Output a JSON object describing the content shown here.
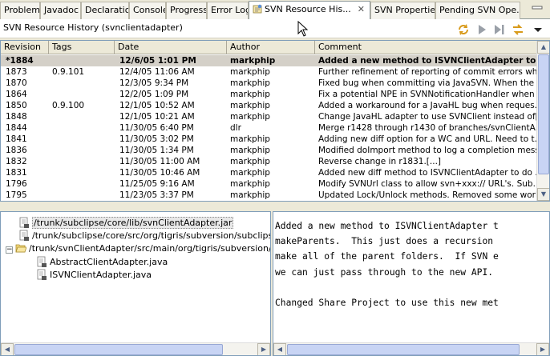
{
  "tabs": [
    {
      "label": "Problems"
    },
    {
      "label": "Javadoc"
    },
    {
      "label": "Declaration"
    },
    {
      "label": "Console"
    },
    {
      "label": "Progress"
    },
    {
      "label": "Error Log"
    },
    {
      "label": "SVN Resource His..."
    },
    {
      "label": "SVN Properties"
    },
    {
      "label": "Pending SVN Ope..."
    }
  ],
  "view": {
    "title": "SVN Resource History (svnclientadapter)"
  },
  "table": {
    "columns": [
      "Revision",
      "Tags",
      "Date",
      "Author",
      "Comment"
    ],
    "rows": [
      {
        "revision": "*1884",
        "tags": "",
        "date": "12/6/05 1:01 PM",
        "author": "markphip",
        "comment": "Added a new method to ISVNClientAdapter to..."
      },
      {
        "revision": "1873",
        "tags": "0.9.101",
        "date": "12/4/05 11:06 AM",
        "author": "markphip",
        "comment": "Further refinement of reporting of commit errors wh..."
      },
      {
        "revision": "1870",
        "tags": "",
        "date": "12/3/05 9:34 PM",
        "author": "markphip",
        "comment": "Fixed bug when committing via JavaSVN.  When the ..."
      },
      {
        "revision": "1864",
        "tags": "",
        "date": "12/2/05 1:09 PM",
        "author": "markphip",
        "comment": "Fix a potential NPE in SVNNotificationHandler when u..."
      },
      {
        "revision": "1850",
        "tags": "0.9.100",
        "date": "12/1/05 10:52 AM",
        "author": "markphip",
        "comment": "Added a workaround for a JavaHL bug when reques..."
      },
      {
        "revision": "1848",
        "tags": "",
        "date": "12/1/05 10:21 AM",
        "author": "markphip",
        "comment": "Change JavaHL adapter to use SVNClient instead of[..."
      },
      {
        "revision": "1844",
        "tags": "",
        "date": "11/30/05 6:40 PM",
        "author": "dlr",
        "comment": "Merge r1428 through r1430 of branches/svnClientA..."
      },
      {
        "revision": "1841",
        "tags": "",
        "date": "11/30/05 3:02 PM",
        "author": "markphip",
        "comment": "Adding new diff option for a WC and URL.  Need to t..."
      },
      {
        "revision": "1836",
        "tags": "",
        "date": "11/30/05 1:34 PM",
        "author": "markphip",
        "comment": "Modified doImport method to log a completion messa..."
      },
      {
        "revision": "1832",
        "tags": "",
        "date": "11/30/05 11:00 AM",
        "author": "markphip",
        "comment": "Reverse change in r1831.[...]"
      },
      {
        "revision": "1831",
        "tags": "",
        "date": "11/30/05 10:46 AM",
        "author": "markphip",
        "comment": "Added new diff method to ISVNClientAdapter to do ..."
      },
      {
        "revision": "1796",
        "tags": "",
        "date": "11/25/05 9:16 AM",
        "author": "markphip",
        "comment": "Modify SVNUrl class to allow svn+xxx:// URL's.  Sub..."
      },
      {
        "revision": "1795",
        "tags": "",
        "date": "11/23/05 3:37 PM",
        "author": "markphip",
        "comment": "Updated Lock/Unlock methods.  Removed some work..."
      }
    ]
  },
  "tree": {
    "items": [
      {
        "label": "/trunk/subclipse/core/lib/svnClientAdapter.jar"
      },
      {
        "label": "/trunk/subclipse/core/src/org/tigris/subversion/subclipse/core"
      },
      {
        "label": "/trunk/svnClientAdapter/src/main/org/tigris/subversion/svnclie"
      },
      {
        "label": "AbstractClientAdapter.java"
      },
      {
        "label": "ISVNClientAdapter.java"
      }
    ]
  },
  "comment": {
    "text": "Added a new method to ISVNClientAdapter t\nmakeParents.  This just does a recursion \nmake all of the parent folders.  If SVN e\nwe can just pass through to the new API.\n\nChanged Share Project to use this new met"
  },
  "colors": {
    "selection_gray": "#d4d0c8",
    "chrome": "#ece9d8",
    "border_blue": "#7f9db9",
    "scroll_thumb": "#c8d4f4"
  },
  "icons": {
    "tab_svn": "svn-history-icon",
    "refresh": "refresh-icon",
    "next": "play-icon",
    "last": "skip-forward-icon",
    "link": "link-with-editor-icon",
    "menu": "view-menu-chevron-icon"
  }
}
